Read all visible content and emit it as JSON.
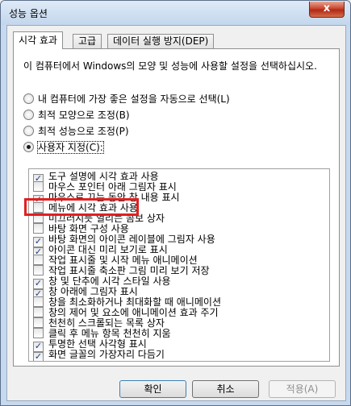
{
  "window": {
    "title": "성능 옵션",
    "close_label": "x"
  },
  "tabs": [
    {
      "label": "시각 효과",
      "active": true
    },
    {
      "label": "고급",
      "active": false
    },
    {
      "label": "데이터 실행 방지(DEP)",
      "active": false
    }
  ],
  "description": "이 컴퓨터에서 Windows의 모양 및 성능에 사용할 설정을 선택하십시오.",
  "radios": [
    {
      "label": "내 컴퓨터에 가장 좋은 설정을 자동으로 선택(L)",
      "selected": false
    },
    {
      "label": "최적 모양으로 조정(B)",
      "selected": false
    },
    {
      "label": "최적 성능으로 조정(P)",
      "selected": false
    },
    {
      "label": "사용자 지정(C):",
      "selected": true
    }
  ],
  "effects": [
    {
      "label": "도구 설명에 시각 효과 사용",
      "checked": true
    },
    {
      "label": "마우스 포인터 아래 그림자 표시",
      "checked": false
    },
    {
      "label": "마우스로 끄는 동안 창 내용 표시",
      "checked": true
    },
    {
      "label": "메뉴에 시각 효과 사용",
      "checked": false
    },
    {
      "label": "미끄러지듯 열리는 콤보 상자",
      "checked": false
    },
    {
      "label": "바탕 화면 구성 사용",
      "checked": false
    },
    {
      "label": "바탕 화면의 아이콘 레이블에 그림자 사용",
      "checked": true
    },
    {
      "label": "아이콘 대신 미리 보기로 표시",
      "checked": true
    },
    {
      "label": "작업 표시줄 및 시작 메뉴 애니메이션",
      "checked": false
    },
    {
      "label": "작업 표시줄 축소판 그림 미리 보기 저장",
      "checked": false
    },
    {
      "label": "창 및 단추에 시각 스타일 사용",
      "checked": true
    },
    {
      "label": "창 아래에 그림자 표시",
      "checked": true
    },
    {
      "label": "창을 최소화하거나 최대화할 때 애니메이션",
      "checked": false
    },
    {
      "label": "창의 제어 및 요소에 애니메이션 효과 주기",
      "checked": false
    },
    {
      "label": "천천히 스크롤되는 목록 상자",
      "checked": false
    },
    {
      "label": "클릭 후 메뉴 항목 천천히 지움",
      "checked": false
    },
    {
      "label": "투명한 선택 사각형 표시",
      "checked": true
    },
    {
      "label": "화면 글꼴의 가장자리 다듬기",
      "checked": true
    }
  ],
  "check_glyph": "✓",
  "buttons": {
    "ok": "확인",
    "cancel": "취소",
    "apply": "적용(A)"
  }
}
